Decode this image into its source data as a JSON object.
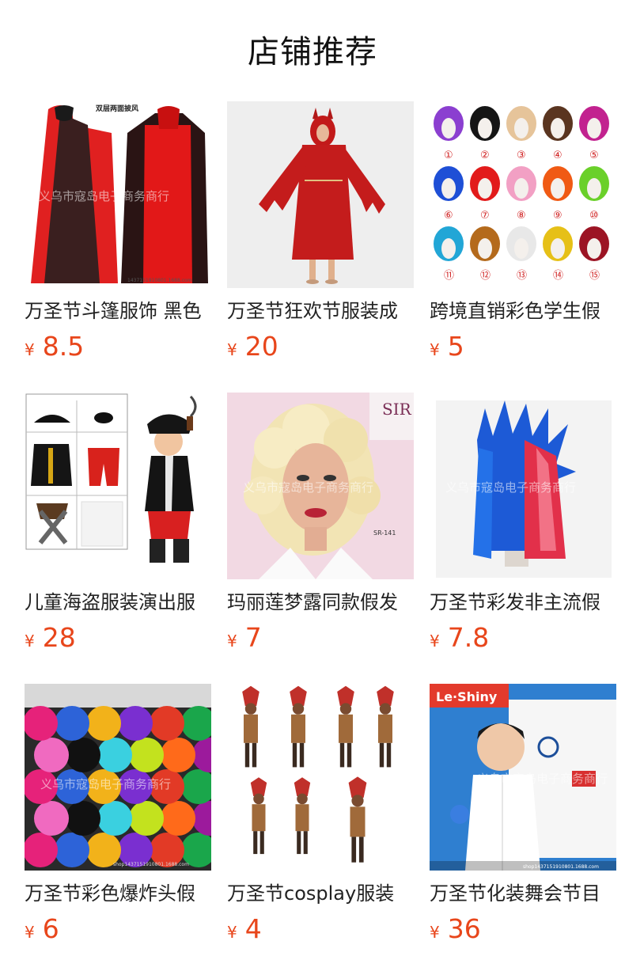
{
  "header": {
    "title": "店铺推荐"
  },
  "currency_symbol": "¥",
  "products": [
    {
      "name": "万圣节斗篷服饰 黑色",
      "price": "8.5",
      "image_text": "双层两面披风",
      "watermark": "义乌市寇岛电子商务商行",
      "store_id": "1437151910801.1688.com"
    },
    {
      "name": "万圣节狂欢节服装成",
      "price": "20"
    },
    {
      "name": "跨境直销彩色学生假",
      "price": "5",
      "image_numbers": [
        "①",
        "②",
        "③",
        "④",
        "⑤",
        "⑥",
        "⑦",
        "⑧",
        "⑨",
        "⑩",
        "⑪",
        "⑫",
        "⑬",
        "⑭",
        "⑮"
      ]
    },
    {
      "name": "儿童海盗服装演出服",
      "price": "28"
    },
    {
      "name": "玛丽莲梦露同款假发",
      "price": "7",
      "image_text": "SR-141",
      "watermark": "义乌市寇岛电子商务商行"
    },
    {
      "name": "万圣节彩发非主流假",
      "price": "7.8",
      "watermark": "义乌市寇岛电子商务商行"
    },
    {
      "name": "万圣节彩色爆炸头假",
      "price": "6",
      "watermark": "义乌市寇岛电子商务商行",
      "store_id": "shop1437151910801.1688.com"
    },
    {
      "name": "万圣节cosplay服装",
      "price": "4"
    },
    {
      "name": "万圣节化装舞会节目",
      "price": "36",
      "watermark": "义乌市寇岛电子商务商行",
      "store_id": "shop1437151910801.1688.com"
    }
  ],
  "colors": {
    "price": "#e8461b",
    "title": "#111111",
    "text": "#222222"
  }
}
